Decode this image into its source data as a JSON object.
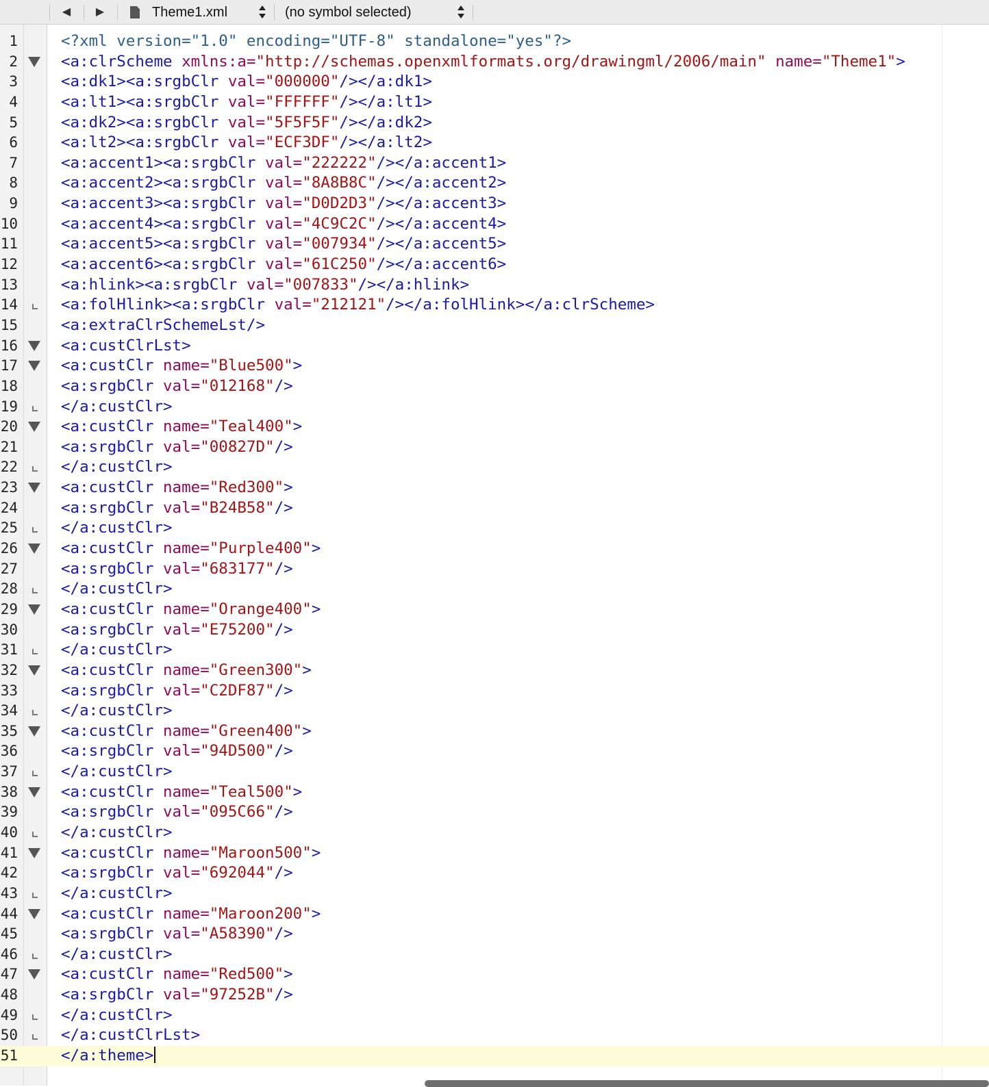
{
  "toolbar": {
    "back_icon": "◀",
    "forward_icon": "▶",
    "file_name": "Theme1.xml",
    "symbol": "(no symbol selected)"
  },
  "editor": {
    "current_line": 51,
    "lines": [
      {
        "n": "1",
        "fold": "",
        "s": [
          {
            "t": "pi",
            "v": "<?xml version=\"1.0\" encoding=\"UTF-8\" standalone=\"yes\"?>"
          }
        ]
      },
      {
        "n": "2",
        "fold": "open",
        "s": [
          {
            "t": "tag",
            "v": "<a:clrScheme "
          },
          {
            "t": "attr",
            "v": "xmlns:a="
          },
          {
            "t": "val",
            "v": "\"http://schemas.openxmlformats.org/drawingml/2006/main\" "
          },
          {
            "t": "attr",
            "v": "name="
          },
          {
            "t": "val",
            "v": "\"Theme1\""
          },
          {
            "t": "tag",
            "v": ">"
          }
        ]
      },
      {
        "n": "3",
        "fold": "",
        "s": [
          {
            "t": "tag",
            "v": "<a:dk1><a:srgbClr "
          },
          {
            "t": "attr",
            "v": "val="
          },
          {
            "t": "val",
            "v": "\"000000\""
          },
          {
            "t": "tag",
            "v": "/></a:dk1>"
          }
        ]
      },
      {
        "n": "4",
        "fold": "",
        "s": [
          {
            "t": "tag",
            "v": "<a:lt1><a:srgbClr "
          },
          {
            "t": "attr",
            "v": "val="
          },
          {
            "t": "val",
            "v": "\"FFFFFF\""
          },
          {
            "t": "tag",
            "v": "/></a:lt1>"
          }
        ]
      },
      {
        "n": "5",
        "fold": "",
        "s": [
          {
            "t": "tag",
            "v": "<a:dk2><a:srgbClr "
          },
          {
            "t": "attr",
            "v": "val="
          },
          {
            "t": "val",
            "v": "\"5F5F5F\""
          },
          {
            "t": "tag",
            "v": "/></a:dk2>"
          }
        ]
      },
      {
        "n": "6",
        "fold": "",
        "s": [
          {
            "t": "tag",
            "v": "<a:lt2><a:srgbClr "
          },
          {
            "t": "attr",
            "v": "val="
          },
          {
            "t": "val",
            "v": "\"ECF3DF\""
          },
          {
            "t": "tag",
            "v": "/></a:lt2>"
          }
        ]
      },
      {
        "n": "7",
        "fold": "",
        "s": [
          {
            "t": "tag",
            "v": "<a:accent1><a:srgbClr "
          },
          {
            "t": "attr",
            "v": "val="
          },
          {
            "t": "val",
            "v": "\"222222\""
          },
          {
            "t": "tag",
            "v": "/></a:accent1>"
          }
        ]
      },
      {
        "n": "8",
        "fold": "",
        "s": [
          {
            "t": "tag",
            "v": "<a:accent2><a:srgbClr "
          },
          {
            "t": "attr",
            "v": "val="
          },
          {
            "t": "val",
            "v": "\"8A8B8C\""
          },
          {
            "t": "tag",
            "v": "/></a:accent2>"
          }
        ]
      },
      {
        "n": "9",
        "fold": "",
        "s": [
          {
            "t": "tag",
            "v": "<a:accent3><a:srgbClr "
          },
          {
            "t": "attr",
            "v": "val="
          },
          {
            "t": "val",
            "v": "\"D0D2D3\""
          },
          {
            "t": "tag",
            "v": "/></a:accent3>"
          }
        ]
      },
      {
        "n": "10",
        "fold": "",
        "s": [
          {
            "t": "tag",
            "v": "<a:accent4><a:srgbClr "
          },
          {
            "t": "attr",
            "v": "val="
          },
          {
            "t": "val",
            "v": "\"4C9C2C\""
          },
          {
            "t": "tag",
            "v": "/></a:accent4>"
          }
        ]
      },
      {
        "n": "11",
        "fold": "",
        "s": [
          {
            "t": "tag",
            "v": "<a:accent5><a:srgbClr "
          },
          {
            "t": "attr",
            "v": "val="
          },
          {
            "t": "val",
            "v": "\"007934\""
          },
          {
            "t": "tag",
            "v": "/></a:accent5>"
          }
        ]
      },
      {
        "n": "12",
        "fold": "",
        "s": [
          {
            "t": "tag",
            "v": "<a:accent6><a:srgbClr "
          },
          {
            "t": "attr",
            "v": "val="
          },
          {
            "t": "val",
            "v": "\"61C250\""
          },
          {
            "t": "tag",
            "v": "/></a:accent6>"
          }
        ]
      },
      {
        "n": "13",
        "fold": "",
        "s": [
          {
            "t": "tag",
            "v": "<a:hlink><a:srgbClr "
          },
          {
            "t": "attr",
            "v": "val="
          },
          {
            "t": "val",
            "v": "\"007833\""
          },
          {
            "t": "tag",
            "v": "/></a:hlink>"
          }
        ]
      },
      {
        "n": "14",
        "fold": "end",
        "s": [
          {
            "t": "tag",
            "v": "<a:folHlink><a:srgbClr "
          },
          {
            "t": "attr",
            "v": "val="
          },
          {
            "t": "val",
            "v": "\"212121\""
          },
          {
            "t": "tag",
            "v": "/></a:folHlink></a:clrScheme>"
          }
        ]
      },
      {
        "n": "15",
        "fold": "",
        "s": [
          {
            "t": "tag",
            "v": "<a:extraClrSchemeLst/>"
          }
        ]
      },
      {
        "n": "16",
        "fold": "open",
        "s": [
          {
            "t": "tag",
            "v": "<a:custClrLst>"
          }
        ]
      },
      {
        "n": "17",
        "fold": "open",
        "s": [
          {
            "t": "tag",
            "v": "<a:custClr "
          },
          {
            "t": "attr",
            "v": "name="
          },
          {
            "t": "val",
            "v": "\"Blue500\""
          },
          {
            "t": "tag",
            "v": ">"
          }
        ]
      },
      {
        "n": "18",
        "fold": "",
        "s": [
          {
            "t": "tag",
            "v": "<a:srgbClr "
          },
          {
            "t": "attr",
            "v": "val="
          },
          {
            "t": "val",
            "v": "\"012168\""
          },
          {
            "t": "tag",
            "v": "/>"
          }
        ]
      },
      {
        "n": "19",
        "fold": "end",
        "s": [
          {
            "t": "tag",
            "v": "</a:custClr>"
          }
        ]
      },
      {
        "n": "20",
        "fold": "open",
        "s": [
          {
            "t": "tag",
            "v": "<a:custClr "
          },
          {
            "t": "attr",
            "v": "name="
          },
          {
            "t": "val",
            "v": "\"Teal400\""
          },
          {
            "t": "tag",
            "v": ">"
          }
        ]
      },
      {
        "n": "21",
        "fold": "",
        "s": [
          {
            "t": "tag",
            "v": "<a:srgbClr "
          },
          {
            "t": "attr",
            "v": "val="
          },
          {
            "t": "val",
            "v": "\"00827D\""
          },
          {
            "t": "tag",
            "v": "/>"
          }
        ]
      },
      {
        "n": "22",
        "fold": "end",
        "s": [
          {
            "t": "tag",
            "v": "</a:custClr>"
          }
        ]
      },
      {
        "n": "23",
        "fold": "open",
        "s": [
          {
            "t": "tag",
            "v": "<a:custClr "
          },
          {
            "t": "attr",
            "v": "name="
          },
          {
            "t": "val",
            "v": "\"Red300\""
          },
          {
            "t": "tag",
            "v": ">"
          }
        ]
      },
      {
        "n": "24",
        "fold": "",
        "s": [
          {
            "t": "tag",
            "v": "<a:srgbClr "
          },
          {
            "t": "attr",
            "v": "val="
          },
          {
            "t": "val",
            "v": "\"B24B58\""
          },
          {
            "t": "tag",
            "v": "/>"
          }
        ]
      },
      {
        "n": "25",
        "fold": "end",
        "s": [
          {
            "t": "tag",
            "v": "</a:custClr>"
          }
        ]
      },
      {
        "n": "26",
        "fold": "open",
        "s": [
          {
            "t": "tag",
            "v": "<a:custClr "
          },
          {
            "t": "attr",
            "v": "name="
          },
          {
            "t": "val",
            "v": "\"Purple400\""
          },
          {
            "t": "tag",
            "v": ">"
          }
        ]
      },
      {
        "n": "27",
        "fold": "",
        "s": [
          {
            "t": "tag",
            "v": "<a:srgbClr "
          },
          {
            "t": "attr",
            "v": "val="
          },
          {
            "t": "val",
            "v": "\"683177\""
          },
          {
            "t": "tag",
            "v": "/>"
          }
        ]
      },
      {
        "n": "28",
        "fold": "end",
        "s": [
          {
            "t": "tag",
            "v": "</a:custClr>"
          }
        ]
      },
      {
        "n": "29",
        "fold": "open",
        "s": [
          {
            "t": "tag",
            "v": "<a:custClr "
          },
          {
            "t": "attr",
            "v": "name="
          },
          {
            "t": "val",
            "v": "\"Orange400\""
          },
          {
            "t": "tag",
            "v": ">"
          }
        ]
      },
      {
        "n": "30",
        "fold": "",
        "s": [
          {
            "t": "tag",
            "v": "<a:srgbClr "
          },
          {
            "t": "attr",
            "v": "val="
          },
          {
            "t": "val",
            "v": "\"E75200\""
          },
          {
            "t": "tag",
            "v": "/>"
          }
        ]
      },
      {
        "n": "31",
        "fold": "end",
        "s": [
          {
            "t": "tag",
            "v": "</a:custClr>"
          }
        ]
      },
      {
        "n": "32",
        "fold": "open",
        "s": [
          {
            "t": "tag",
            "v": "<a:custClr "
          },
          {
            "t": "attr",
            "v": "name="
          },
          {
            "t": "val",
            "v": "\"Green300\""
          },
          {
            "t": "tag",
            "v": ">"
          }
        ]
      },
      {
        "n": "33",
        "fold": "",
        "s": [
          {
            "t": "tag",
            "v": "<a:srgbClr "
          },
          {
            "t": "attr",
            "v": "val="
          },
          {
            "t": "val",
            "v": "\"C2DF87\""
          },
          {
            "t": "tag",
            "v": "/>"
          }
        ]
      },
      {
        "n": "34",
        "fold": "end",
        "s": [
          {
            "t": "tag",
            "v": "</a:custClr>"
          }
        ]
      },
      {
        "n": "35",
        "fold": "open",
        "s": [
          {
            "t": "tag",
            "v": "<a:custClr "
          },
          {
            "t": "attr",
            "v": "name="
          },
          {
            "t": "val",
            "v": "\"Green400\""
          },
          {
            "t": "tag",
            "v": ">"
          }
        ]
      },
      {
        "n": "36",
        "fold": "",
        "s": [
          {
            "t": "tag",
            "v": "<a:srgbClr "
          },
          {
            "t": "attr",
            "v": "val="
          },
          {
            "t": "val",
            "v": "\"94D500\""
          },
          {
            "t": "tag",
            "v": "/>"
          }
        ]
      },
      {
        "n": "37",
        "fold": "end",
        "s": [
          {
            "t": "tag",
            "v": "</a:custClr>"
          }
        ]
      },
      {
        "n": "38",
        "fold": "open",
        "s": [
          {
            "t": "tag",
            "v": "<a:custClr "
          },
          {
            "t": "attr",
            "v": "name="
          },
          {
            "t": "val",
            "v": "\"Teal500\""
          },
          {
            "t": "tag",
            "v": ">"
          }
        ]
      },
      {
        "n": "39",
        "fold": "",
        "s": [
          {
            "t": "tag",
            "v": "<a:srgbClr "
          },
          {
            "t": "attr",
            "v": "val="
          },
          {
            "t": "val",
            "v": "\"095C66\""
          },
          {
            "t": "tag",
            "v": "/>"
          }
        ]
      },
      {
        "n": "40",
        "fold": "end",
        "s": [
          {
            "t": "tag",
            "v": "</a:custClr>"
          }
        ]
      },
      {
        "n": "41",
        "fold": "open",
        "s": [
          {
            "t": "tag",
            "v": "<a:custClr "
          },
          {
            "t": "attr",
            "v": "name="
          },
          {
            "t": "val",
            "v": "\"Maroon500\""
          },
          {
            "t": "tag",
            "v": ">"
          }
        ]
      },
      {
        "n": "42",
        "fold": "",
        "s": [
          {
            "t": "tag",
            "v": "<a:srgbClr "
          },
          {
            "t": "attr",
            "v": "val="
          },
          {
            "t": "val",
            "v": "\"692044\""
          },
          {
            "t": "tag",
            "v": "/>"
          }
        ]
      },
      {
        "n": "43",
        "fold": "end",
        "s": [
          {
            "t": "tag",
            "v": "</a:custClr>"
          }
        ]
      },
      {
        "n": "44",
        "fold": "open",
        "s": [
          {
            "t": "tag",
            "v": "<a:custClr "
          },
          {
            "t": "attr",
            "v": "name="
          },
          {
            "t": "val",
            "v": "\"Maroon200\""
          },
          {
            "t": "tag",
            "v": ">"
          }
        ]
      },
      {
        "n": "45",
        "fold": "",
        "s": [
          {
            "t": "tag",
            "v": "<a:srgbClr "
          },
          {
            "t": "attr",
            "v": "val="
          },
          {
            "t": "val",
            "v": "\"A58390\""
          },
          {
            "t": "tag",
            "v": "/>"
          }
        ]
      },
      {
        "n": "46",
        "fold": "end",
        "s": [
          {
            "t": "tag",
            "v": "</a:custClr>"
          }
        ]
      },
      {
        "n": "47",
        "fold": "open",
        "s": [
          {
            "t": "tag",
            "v": "<a:custClr "
          },
          {
            "t": "attr",
            "v": "name="
          },
          {
            "t": "val",
            "v": "\"Red500\""
          },
          {
            "t": "tag",
            "v": ">"
          }
        ]
      },
      {
        "n": "48",
        "fold": "",
        "s": [
          {
            "t": "tag",
            "v": "<a:srgbClr "
          },
          {
            "t": "attr",
            "v": "val="
          },
          {
            "t": "val",
            "v": "\"97252B\""
          },
          {
            "t": "tag",
            "v": "/>"
          }
        ]
      },
      {
        "n": "49",
        "fold": "end",
        "s": [
          {
            "t": "tag",
            "v": "</a:custClr>"
          }
        ]
      },
      {
        "n": "50",
        "fold": "end",
        "s": [
          {
            "t": "tag",
            "v": "</a:custClrLst>"
          }
        ]
      },
      {
        "n": "51",
        "fold": "",
        "s": [
          {
            "t": "tag",
            "v": "</a:theme>"
          }
        ]
      }
    ]
  }
}
